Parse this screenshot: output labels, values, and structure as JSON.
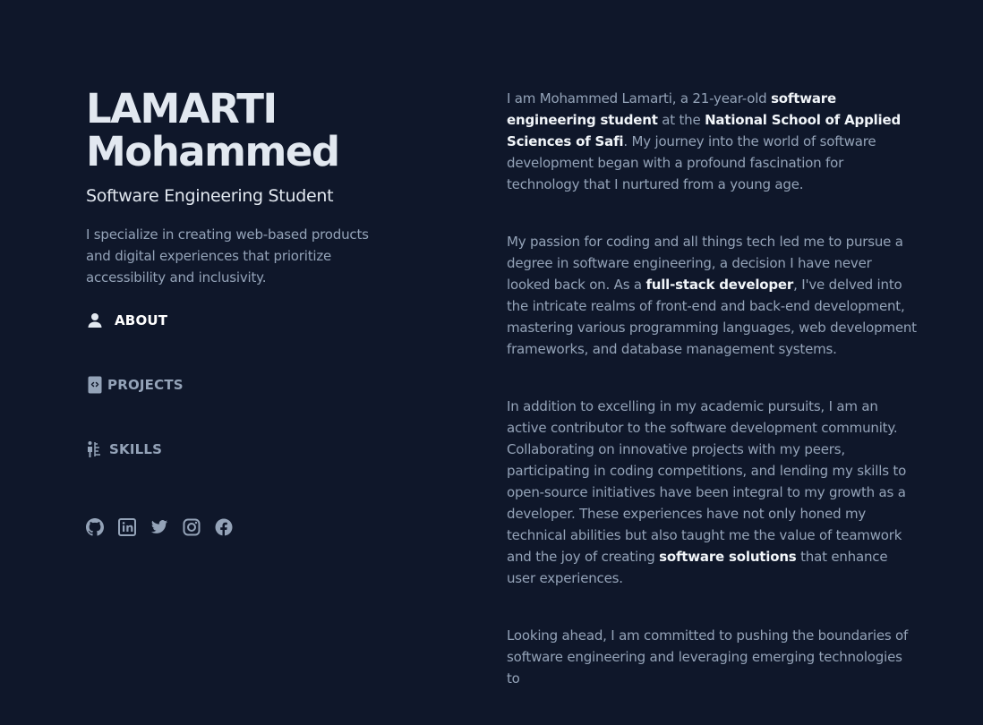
{
  "header": {
    "name_line1": "LAMARTI",
    "name_line2": "Mohammed",
    "role": "Software Engineering Student",
    "intro": "I specialize in creating web-based products and digital experiences that prioritize accessibility and inclusivity."
  },
  "nav": {
    "items": [
      {
        "label": "ABOUT",
        "icon": "person-icon",
        "active": true
      },
      {
        "label": "PROJECTS",
        "icon": "code-file-icon",
        "active": false
      },
      {
        "label": "SKILLS",
        "icon": "skills-chart-icon",
        "active": false
      }
    ]
  },
  "socials": [
    {
      "name": "GitHub",
      "icon": "github-icon"
    },
    {
      "name": "LinkedIn",
      "icon": "linkedin-icon"
    },
    {
      "name": "Twitter",
      "icon": "twitter-icon"
    },
    {
      "name": "Instagram",
      "icon": "instagram-icon"
    },
    {
      "name": "Facebook",
      "icon": "facebook-icon"
    }
  ],
  "about": {
    "p1": {
      "t1": "I am Mohammed Lamarti, a 21-year-old ",
      "b1": "software engineering student",
      "t2": " at the ",
      "b2": "National School of Applied Sciences of Safi",
      "t3": ". My journey into the world of software development began with a profound fascination for technology that I nurtured from a young age."
    },
    "p2": {
      "t1": "My passion for coding and all things tech led me to pursue a degree in software engineering, a decision I have never looked back on. As a ",
      "b1": "full-stack developer",
      "t2": ", I've delved into the intricate realms of front-end and back-end development, mastering various programming languages, web development frameworks, and database management systems."
    },
    "p3": {
      "t1": "In addition to excelling in my academic pursuits, I am an active contributor to the software development community. Collaborating on innovative projects with my peers, participating in coding competitions, and lending my skills to open-source initiatives have been integral to my growth as a developer. These experiences have not only honed my technical abilities but also taught me the value of teamwork and the joy of creating ",
      "b1": "software solutions",
      "t2": " that enhance user experiences."
    },
    "p4": {
      "t1": "Looking ahead, I am committed to pushing the boundaries of software engineering and leveraging emerging technologies to"
    }
  },
  "colors": {
    "background": "#0f172a",
    "heading": "#e2e8f0",
    "body_text": "#94a3b8",
    "highlight": "#f1f5f9"
  }
}
